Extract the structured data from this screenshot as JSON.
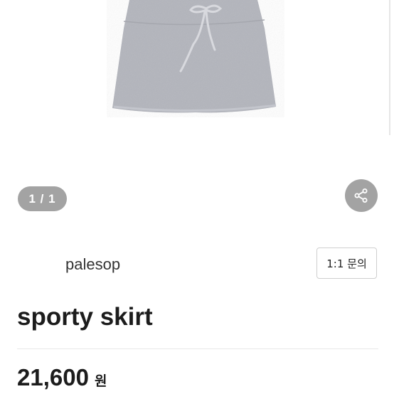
{
  "gallery": {
    "image_alt": "gray sporty skirt with drawstring waist",
    "pager_text": "1 / 1",
    "share_icon": "share-icon"
  },
  "seller": {
    "name": "palesop"
  },
  "actions": {
    "inquiry_label": "1:1 문의"
  },
  "product": {
    "title": "sporty skirt",
    "price": "21,600",
    "currency": "원"
  },
  "colors": {
    "skirt": "#b7b9c0",
    "pill": "#a3a3a3"
  }
}
